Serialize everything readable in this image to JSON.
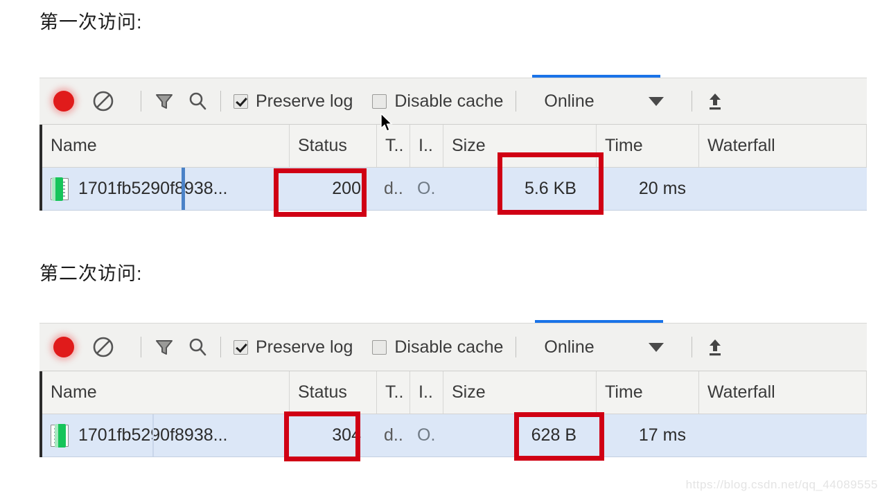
{
  "headings": {
    "first_visit": "第一次访问:",
    "second_visit": "第二次访问:"
  },
  "toolbar": {
    "record_icon": "record-circle-icon",
    "clear_icon": "clear-prohibited-icon",
    "filter_icon": "filter-funnel-icon",
    "search_icon": "search-magnifier-icon",
    "preserve_log_label": "Preserve log",
    "preserve_log_checked": true,
    "disable_cache_label": "Disable cache",
    "disable_cache_checked": false,
    "throttle_value": "Online",
    "throttle_caret": "chevron-down-icon",
    "import_icon": "import-upload-icon",
    "tab_indicator_color": "#1a73e8"
  },
  "table": {
    "columns": [
      "Name",
      "Status",
      "T..",
      "I..",
      "Size",
      "Time",
      "Waterfall"
    ]
  },
  "panels": [
    {
      "id": "panel-1",
      "row": {
        "name": "1701fb5290f8938...",
        "status": "200",
        "type": "d..",
        "initiator": "O.",
        "size": "5.6 KB",
        "time": "20 ms"
      }
    },
    {
      "id": "panel-2",
      "row": {
        "name": "1701fb5290f8938...",
        "status": "304",
        "type": "d..",
        "initiator": "O.",
        "size": "628 B",
        "time": "17 ms"
      }
    }
  ],
  "annotations": {
    "color": "#d00014",
    "targets": [
      "status-200",
      "size-5.6KB",
      "status-304",
      "size-628B"
    ]
  },
  "watermark": "https://blog.csdn.net/qq_44089555"
}
